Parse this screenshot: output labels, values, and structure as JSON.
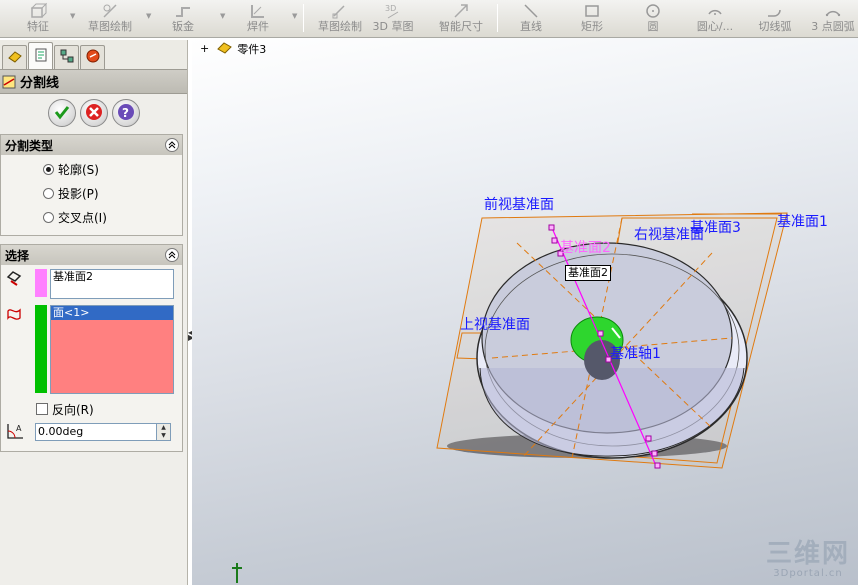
{
  "toolbar": {
    "buttons": [
      {
        "label": "特征",
        "icon": "feature-icon"
      },
      {
        "label": "草图绘制",
        "icon": "sketch-icon"
      },
      {
        "label": "钣金",
        "icon": "sheet-metal-icon"
      },
      {
        "label": "焊件",
        "icon": "weldment-icon"
      },
      {
        "label": "草图绘制",
        "icon": "sketch-icon"
      },
      {
        "label": "3D 草图",
        "icon": "3d-sketch-icon"
      },
      {
        "label": "智能尺寸",
        "icon": "smart-dimension-icon"
      },
      {
        "label": "直线",
        "icon": "line-icon"
      },
      {
        "label": "矩形",
        "icon": "rectangle-icon"
      },
      {
        "label": "圆",
        "icon": "circle-icon"
      },
      {
        "label": "圆心/...",
        "icon": "centerpoint-arc-icon"
      },
      {
        "label": "切线弧",
        "icon": "tangent-arc-icon"
      },
      {
        "label": "3 点圆弧",
        "icon": "three-point-arc-icon"
      }
    ]
  },
  "panel": {
    "title": "分割线",
    "split_type": {
      "heading": "分割类型",
      "options": [
        "轮廓(S)",
        "投影(P)",
        "交叉点(I)"
      ],
      "selected": "轮廓(S)"
    },
    "selection": {
      "heading": "选择",
      "plane_value": "基准面2",
      "faces": [
        "面<1>"
      ],
      "reverse_label": "反向(R)",
      "angle_value": "0.00deg"
    },
    "colors": {
      "plane_bar": "#ff80ff",
      "face_bar": "#00c000",
      "face_list_bg": "#ff8080"
    }
  },
  "viewport": {
    "tree_item": "零件3",
    "labels": {
      "front_plane": "前视基准面",
      "plane3": "基准面3",
      "plane1": "基准面1",
      "right_plane": "右视基准面",
      "plane2": "基准面2",
      "top_plane": "上视基准面",
      "axis1": "基准轴1",
      "tooltip": "基准面2"
    },
    "watermark": {
      "main": "三维网",
      "sub": "3Dportal.cn"
    }
  }
}
